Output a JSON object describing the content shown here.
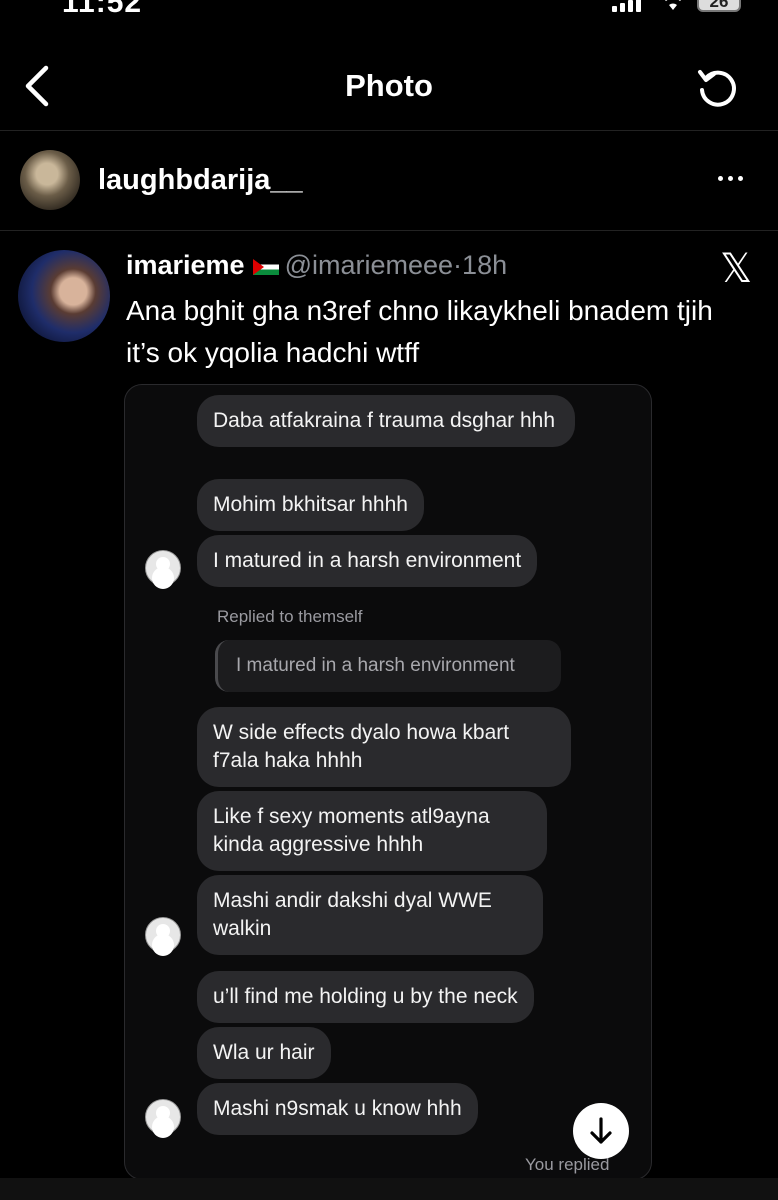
{
  "status": {
    "time": "11:52",
    "battery": "26"
  },
  "header": {
    "title": "Photo"
  },
  "author": {
    "username": "laughbdarija__"
  },
  "tweet": {
    "name": "imarieme",
    "handle": "@imariemeee",
    "separator": "·",
    "time": "18h",
    "text": "Ana bghit gha n3ref chno likaykheli bnadem tjih it’s ok yqolia hadchi wtff",
    "platform_icon": "x-logo"
  },
  "chat": {
    "messages": [
      "Daba atfakraina f trauma dsghar hhh",
      "Mohim bkhitsar hhhh",
      "I matured in a harsh environment",
      "W side effects dyalo howa kbart f7ala haka hhhh",
      "Like f sexy moments atl9ayna kinda aggressive hhhh",
      "Mashi andir dakshi dyal WWE walkin",
      "u’ll find me holding u by the neck",
      "Wla ur hair",
      "Mashi n9smak u know hhh"
    ],
    "replied_note": "Replied to themself",
    "quoted_text": "I matured in a harsh environment",
    "footer": "You replied"
  },
  "colors": {
    "background": "#000000",
    "bubble": "#2a2a2d",
    "muted": "#8b8f96"
  }
}
